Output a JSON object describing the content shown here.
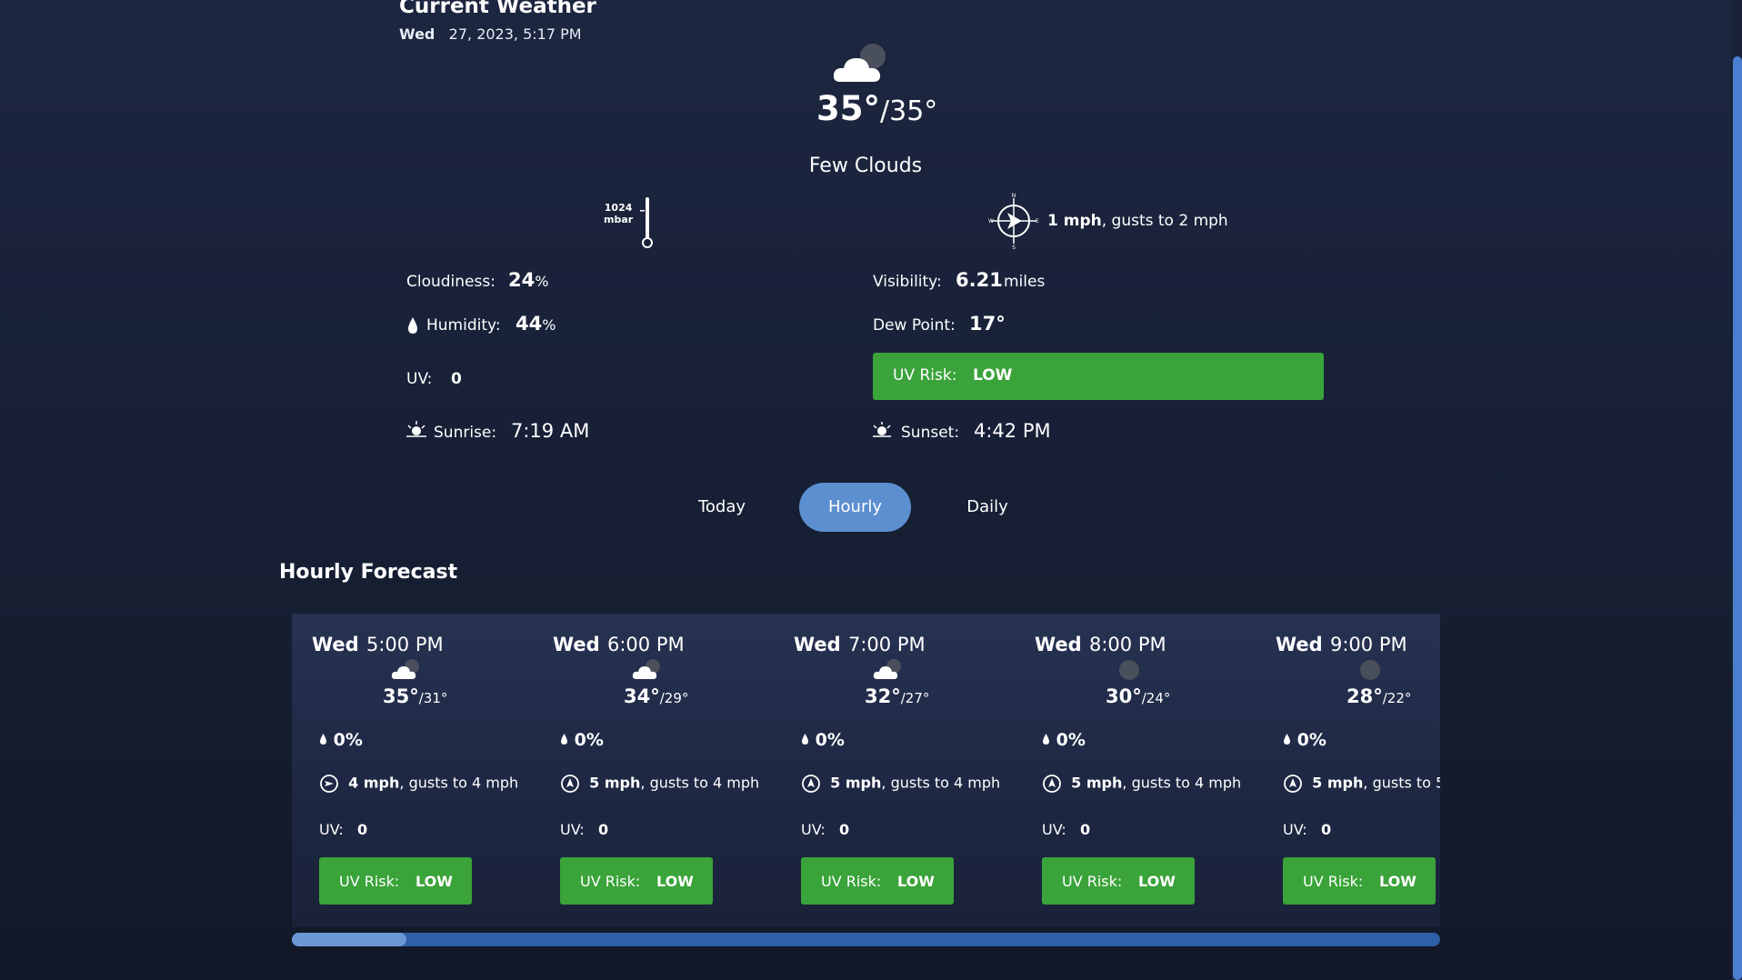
{
  "current": {
    "title": "Current Weather",
    "day": "Wed",
    "date": "27, 2023, 5:17 PM",
    "icon": "few-clouds-icon",
    "high": "35°",
    "low": "35°",
    "description": "Few Clouds",
    "pressure_value": "1024",
    "pressure_unit": "mbar",
    "wind_speed": "1 mph",
    "wind_gusts": ", gusts to 2 mph",
    "cloudiness_label": "Cloudiness:",
    "cloudiness_value": "24",
    "humidity_label": "Humidity:",
    "humidity_value": "44",
    "percent": "%",
    "visibility_label": "Visibility:",
    "visibility_value": "6.21",
    "visibility_unit": "miles",
    "dew_label": "Dew Point:",
    "dew_value": "17°",
    "uv_label": "UV:",
    "uv_value": "0",
    "uv_risk_label": "UV Risk:",
    "uv_risk_value": "LOW",
    "sunrise_label": "Sunrise:",
    "sunrise_value": "7:19 AM",
    "sunset_label": "Sunset:",
    "sunset_value": "4:42 PM"
  },
  "tabs": [
    {
      "label": "Today",
      "active": false
    },
    {
      "label": "Hourly",
      "active": true
    },
    {
      "label": "Daily",
      "active": false
    }
  ],
  "hourly": {
    "title": "Hourly Forecast",
    "items": [
      {
        "day": "Wed",
        "time": "5:00 PM",
        "icon": "few-clouds-icon",
        "high": "35°",
        "low": "31°",
        "precip": "0%",
        "wind": "4 mph",
        "gusts": ", gusts to 4 mph",
        "uv_label": "UV:",
        "uv": "0",
        "risk_label": "UV Risk:",
        "risk": "LOW"
      },
      {
        "day": "Wed",
        "time": "6:00 PM",
        "icon": "few-clouds-icon",
        "high": "34°",
        "low": "29°",
        "precip": "0%",
        "wind": "5 mph",
        "gusts": ", gusts to 4 mph",
        "uv_label": "UV:",
        "uv": "0",
        "risk_label": "UV Risk:",
        "risk": "LOW"
      },
      {
        "day": "Wed",
        "time": "7:00 PM",
        "icon": "few-clouds-icon",
        "high": "32°",
        "low": "27°",
        "precip": "0%",
        "wind": "5 mph",
        "gusts": ", gusts to 4 mph",
        "uv_label": "UV:",
        "uv": "0",
        "risk_label": "UV Risk:",
        "risk": "LOW"
      },
      {
        "day": "Wed",
        "time": "8:00 PM",
        "icon": "clear-night-icon",
        "high": "30°",
        "low": "24°",
        "precip": "0%",
        "wind": "5 mph",
        "gusts": ", gusts to 4 mph",
        "uv_label": "UV:",
        "uv": "0",
        "risk_label": "UV Risk:",
        "risk": "LOW"
      },
      {
        "day": "Wed",
        "time": "9:00 PM",
        "icon": "clear-night-icon",
        "high": "28°",
        "low": "22°",
        "precip": "0%",
        "wind": "5 mph",
        "gusts": ", gusts to 5",
        "uv_label": "UV:",
        "uv": "0",
        "risk_label": "UV Risk:",
        "risk": "LOW"
      }
    ]
  },
  "colors": {
    "background": "#1a2238",
    "uv_low": "#3aa33a",
    "tab_active": "#5c8fd0",
    "scroll_track": "#2f5fa6",
    "scroll_thumb": "#6b98d4"
  },
  "scroll": {
    "horizontal_position": 0.1
  }
}
